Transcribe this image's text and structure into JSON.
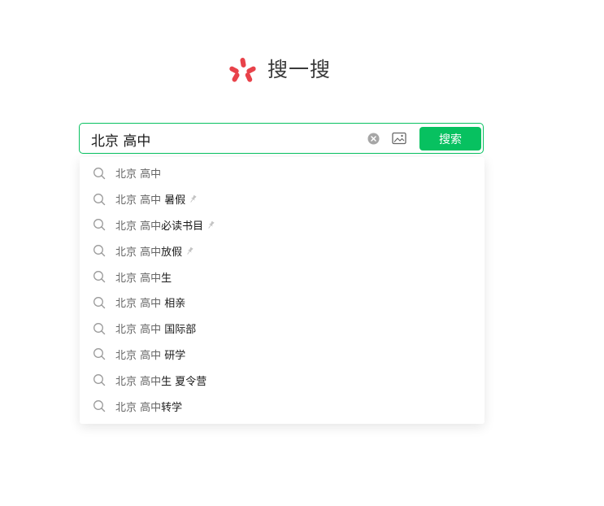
{
  "logo": {
    "text": "搜一搜",
    "brand_color": "#e8424a"
  },
  "search": {
    "value": "北京 高中",
    "button_label": "搜索",
    "accent_color": "#07c160",
    "clear_icon": "clear-circle-icon",
    "image_icon": "image-search-icon"
  },
  "suggestions": [
    {
      "prefix": "北京 高中",
      "suffix": "",
      "pinned": false
    },
    {
      "prefix": "北京 高中",
      "suffix": " 暑假",
      "pinned": true
    },
    {
      "prefix": "北京 高中",
      "suffix": "必读书目",
      "pinned": true
    },
    {
      "prefix": "北京 高中",
      "suffix": "放假",
      "pinned": true
    },
    {
      "prefix": "北京 高中",
      "suffix": "生",
      "pinned": false
    },
    {
      "prefix": "北京 高中",
      "suffix": " 相亲",
      "pinned": false
    },
    {
      "prefix": "北京 高中",
      "suffix": " 国际部",
      "pinned": false
    },
    {
      "prefix": "北京 高中",
      "suffix": " 研学",
      "pinned": false
    },
    {
      "prefix": "北京 高中",
      "suffix": "生 夏令营",
      "pinned": false
    },
    {
      "prefix": "北京 高中",
      "suffix": "转学",
      "pinned": false
    }
  ]
}
